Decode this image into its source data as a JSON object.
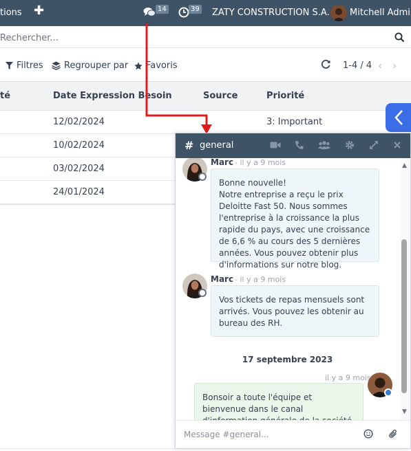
{
  "navbar": {
    "menu_label": "tions",
    "plus_glyph": "✚",
    "messages_count": "14",
    "activities_count": "39",
    "company": "ZATY CONSTRUCTION S.A.",
    "user": "Mitchell Admin"
  },
  "search": {
    "placeholder": "Rechercher..."
  },
  "filters": {
    "filters_label": "Filtres",
    "group_by_label": "Regrouper par",
    "favorites_label": "Favoris"
  },
  "pager": {
    "value": "1-4 / 4"
  },
  "table": {
    "columns": [
      "té",
      "Date Expression Besoin",
      "Source",
      "Priorité"
    ],
    "rows": [
      {
        "date": "12/02/2024",
        "priority": "3: Important"
      },
      {
        "date": "10/02/2024",
        "priority": ""
      },
      {
        "date": "03/02/2024",
        "priority": ""
      },
      {
        "date": "24/01/2024",
        "priority": ""
      }
    ]
  },
  "chat": {
    "title": "general",
    "messages": [
      {
        "author": "Marc",
        "time": "- il y a 9 mois",
        "text": "Bonne nouvelle!\nNotre entreprise a reçu le prix Deloitte Fast 50. Nous sommes l'entreprise à la croissance la plus rapide du pays, avec une croissance de 6,6 % au cours des 5 dernières années. Vous pouvez obtenir plus d'informations sur notre blog."
      },
      {
        "author": "Marc",
        "time": "- il y a 9 mois",
        "text": "Vos tickets de repas mensuels sont arrivés. Vous pouvez les obtenir au bureau des RH."
      }
    ],
    "date_separator": "17 septembre 2023",
    "self_message": {
      "time": "il y a 9 mois",
      "text": "Bonsoir a toute l'équipe et bienvenue dans le canal d'information générale de la société"
    },
    "composer_placeholder": "Message #general..."
  },
  "colors": {
    "navbar": "#3f5366",
    "accent_blue": "#3b6ee6",
    "annotation_red": "#e01b1b",
    "bubble_other": "#eef6fa",
    "bubble_self": "#eaf6ea"
  },
  "icons": {
    "navbar": [
      "plus-icon",
      "chat-bubbles-icon",
      "clock-icon",
      "user-avatar"
    ],
    "search": "magnifier-icon",
    "filters": [
      "filter-icon",
      "layers-icon",
      "star-icon"
    ],
    "pager": [
      "refresh-icon",
      "chevron-left-icon",
      "chevron-right-icon"
    ],
    "chat_header": [
      "hash-icon",
      "video-camera-icon",
      "phone-icon",
      "users-icon",
      "gear-icon",
      "expand-icon",
      "close-icon"
    ],
    "composer": [
      "smiley-icon",
      "paperclip-icon"
    ]
  }
}
